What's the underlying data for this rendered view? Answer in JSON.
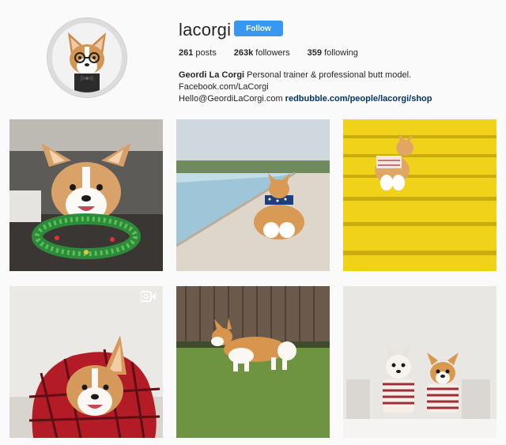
{
  "profile": {
    "username": "lacorgi",
    "follow_label": "Follow",
    "stats": {
      "posts_count": "261",
      "posts_label": "posts",
      "followers_count": "263k",
      "followers_label": "followers",
      "following_count": "359",
      "following_label": "following"
    },
    "bio": {
      "full_name": "Geordi La Corgi",
      "text": " Personal trainer & professional butt model. Facebook.com/LaCorgi",
      "email": "Hello@GeordiLaCorgi.com ",
      "link": "redbubble.com/people/lacorgi/shop"
    }
  },
  "posts": [
    {
      "type": "photo",
      "subject": "corgi with christmas garland"
    },
    {
      "type": "photo",
      "subject": "corgi lying by pool"
    },
    {
      "type": "photo",
      "subject": "corgi on yellow steps"
    },
    {
      "type": "video",
      "subject": "corgi in red plaid blanket"
    },
    {
      "type": "photo",
      "subject": "corgi standing on grass"
    },
    {
      "type": "photo",
      "subject": "two corgis in striped shirts"
    }
  ],
  "colors": {
    "follow_button": "#3897f0",
    "link": "#003569",
    "text": "#262626"
  }
}
